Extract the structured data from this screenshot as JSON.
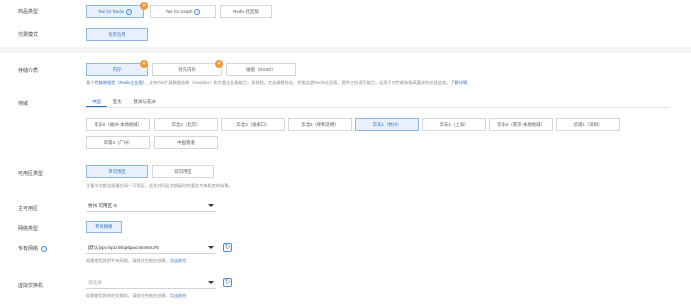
{
  "product_type": {
    "label": "商品类型",
    "options": [
      {
        "label": "Tair for Redis",
        "help": "?",
        "selected": true,
        "badge": "×"
      },
      {
        "label": "Tair for Graph",
        "help": "?",
        "selected": false
      },
      {
        "label": "Redis 社区版",
        "selected": false
      }
    ]
  },
  "billing": {
    "label": "付费模式",
    "options": [
      {
        "label": "包年包月",
        "selected": true
      }
    ]
  },
  "storage": {
    "label": "存储介质",
    "options": [
      {
        "label": "内存",
        "selected": true,
        "badge": "×"
      },
      {
        "label": "持久内存",
        "selected": false,
        "badge": "×"
      },
      {
        "label": "磁盘（ESSD）",
        "selected": false
      }
    ],
    "note_prefix": "基于",
    "note_link1": "性能增强型（Redis企业版）",
    "note_mid": "，支持Tair扩展数据结构（modules）和大量企业级能力，多线程，大连接数优化，性能远超Redis社区版，提供三倍读写能力，适用于对性能有极高要求的在线业务。",
    "note_link2": "了解详情"
  },
  "region": {
    "label": "地域",
    "tabs": [
      "中国",
      "亚太",
      "欧洲与美洲"
    ],
    "row1": [
      "华东6（福州-本地地域）",
      "华北2（北京）",
      "华北3（张家口）",
      "华北5（呼和浩特）",
      "华东1（杭州）",
      "华东2（上海）",
      "华东5（南京-本地地域）",
      "华南1（深圳）"
    ],
    "row2": [
      "华南3（广州）",
      "中国香港"
    ]
  },
  "zone_type": {
    "label": "可用区类型",
    "options": [
      {
        "label": "单可用区",
        "selected": true
      },
      {
        "label": "双可用区",
        "selected": false
      }
    ],
    "note": "主备节点都会部署在同一可用区，适合对同区交换级别的要求为单机房的场景。"
  },
  "primary_zone": {
    "label": "主可用区",
    "value": "杭州 可用区 G"
  },
  "network_type": {
    "label": "网络类型",
    "value": "专有网络"
  },
  "vpc": {
    "label": "专有网络",
    "help": "?",
    "value": "[默认]vpc-bp1nlnbp6pacosm94u76",
    "note": "如需使用其他专有网络，请前往控制台创建。",
    "note_link": "点击前往"
  },
  "vswitch": {
    "label": "虚拟交换机",
    "placeholder": "请选择",
    "note": "如需使用其他的交换机，请前往控制台创建。",
    "note_link": "点击前往"
  },
  "colors": {
    "accent": "#2f6fbf",
    "badge": "#f19a38",
    "selected_bg": "#e8f1fb"
  },
  "icons": {
    "refresh": "↻",
    "dropdown": "caret-down"
  }
}
